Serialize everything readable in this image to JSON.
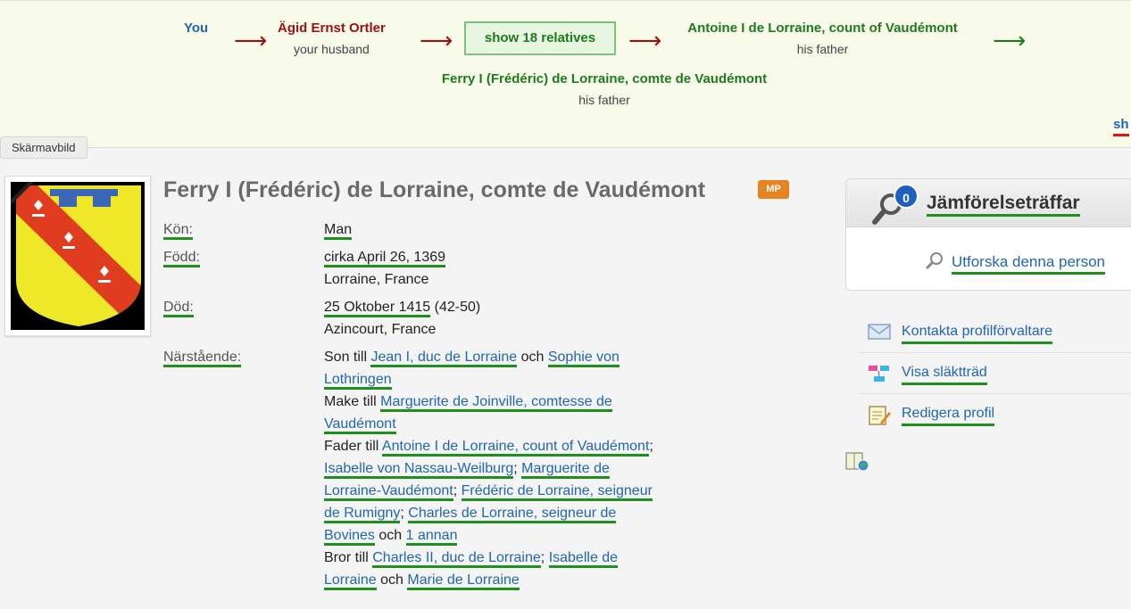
{
  "path": {
    "you": "You",
    "node1": {
      "name": "Ägid Ernst Ortler",
      "relation": "your husband"
    },
    "show_relatives": "show 18 relatives",
    "node2": {
      "name": "Antoine I de Lorraine, count of Vaudémont",
      "relation": "his father"
    },
    "node3": {
      "name": "Ferry I (Frédéric) de Lorraine, comte de Vaudémont",
      "relation": "his father"
    },
    "cut_text": "sh",
    "arrow": "⟶"
  },
  "screenshot_tag": "Skärmavbild",
  "profile": {
    "name": "Ferry I (Frédéric) de Lorraine, comte de Vaudémont",
    "badge": "MP",
    "gender_label": "Kön:",
    "gender": "Man",
    "born_label": "Född:",
    "born_date": "cirka April 26, 1369",
    "born_place": "Lorraine, France",
    "died_label": "Död:",
    "died_date": "25 Oktober 1415",
    "died_age": "(42-50)",
    "died_place": "Azincourt, France",
    "relatives_label": "Närstående:",
    "son_of": "Son till",
    "father1": "Jean I, duc de Lorraine",
    "and": "och",
    "mother1": "Sophie von Lothringen",
    "husband_of": "Make till",
    "wife": "Marguerite de Joinville, comtesse de Vaudémont",
    "father_of": "Fader till",
    "child1": "Antoine I de Lorraine, count of Vaudémont",
    "child2": "Isabelle von Nassau-Weilburg",
    "child3": "Marguerite de Lorraine-Vaudémont",
    "child4": "Frédéric de Lorraine, seigneur de Rumigny",
    "child5": "Charles de Lorraine, seigneur de Bovines",
    "more": "1 annan",
    "brother_of": "Bror till",
    "sib1": "Charles II, duc de Lorraine",
    "sib2": "Isabelle de Lorraine",
    "sib3": "Marie de Lorraine",
    "sep": ";"
  },
  "sidebar": {
    "match_title": "Jämförelseträffar",
    "match_count": "0",
    "explore": "Utforska denna person",
    "items": [
      {
        "label": "Kontakta profilförvaltare",
        "icon": "envelope-icon"
      },
      {
        "label": "Visa släktträd",
        "icon": "family-tree-icon"
      },
      {
        "label": "Redigera profil",
        "icon": "edit-profile-icon"
      }
    ]
  },
  "colors": {
    "link": "#1f66b3",
    "underline": "#1f8f1f",
    "path_red": "#9b1111",
    "path_green": "#1f7a1f",
    "badge": "#e8841f"
  }
}
